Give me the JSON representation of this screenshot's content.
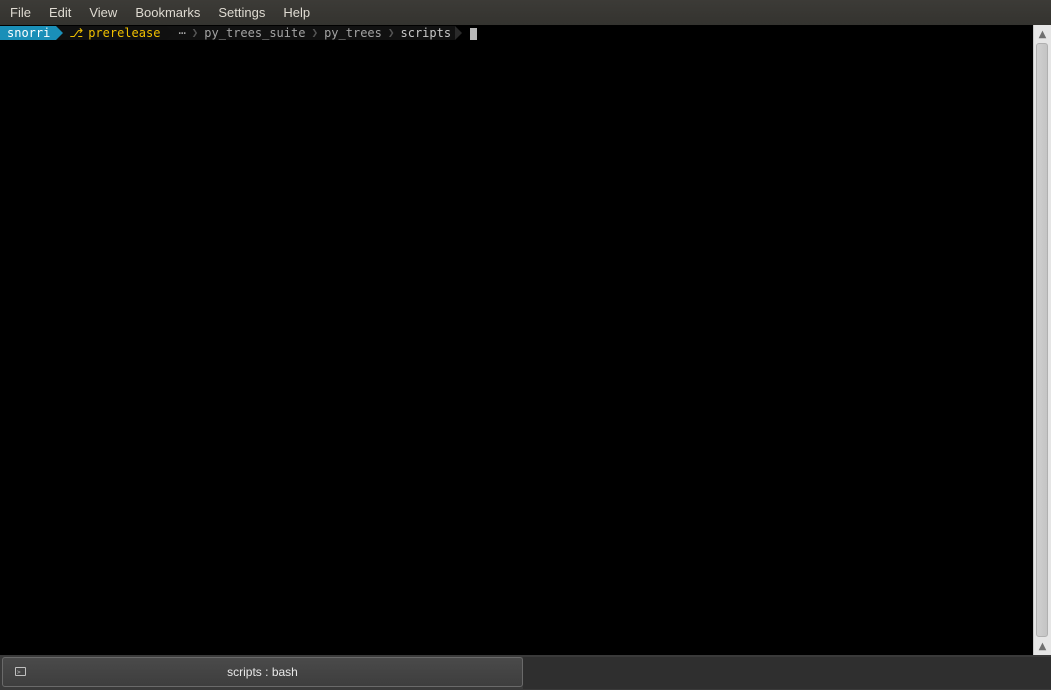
{
  "menu": {
    "items": [
      {
        "label": "File"
      },
      {
        "label": "Edit"
      },
      {
        "label": "View"
      },
      {
        "label": "Bookmarks"
      },
      {
        "label": "Settings"
      },
      {
        "label": "Help"
      }
    ]
  },
  "prompt": {
    "user": "snorri",
    "branch_icon": "⎇",
    "branch": "prerelease",
    "ellipsis": "⋯",
    "path": [
      "py_trees_suite",
      "py_trees",
      "scripts"
    ],
    "separator": "❯"
  },
  "tab": {
    "label": "scripts : bash",
    "icon": "terminal-icon"
  },
  "colors": {
    "user_segment": "#1a8fb8",
    "branch_text": "#f0c000",
    "terminal_bg": "#000000"
  }
}
